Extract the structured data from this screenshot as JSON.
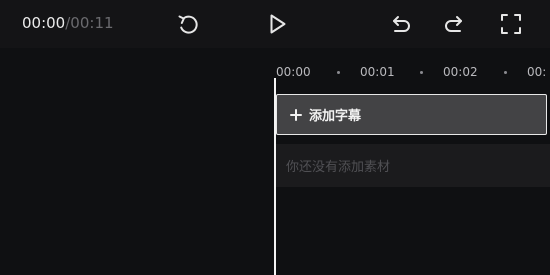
{
  "toolbar": {
    "current_time": "00:00",
    "separator": "/",
    "total_time": "00:11",
    "icons": [
      "refresh-icon",
      "play-icon",
      "undo-icon",
      "redo-icon",
      "fullscreen-icon"
    ]
  },
  "timeline": {
    "ticks": [
      "00:00",
      "00:01",
      "00:02",
      "00:"
    ],
    "subtitle_track_label": "添加字幕",
    "material_track_placeholder": "你还没有添加素材"
  },
  "colors": {
    "background": "#0f1012",
    "toolbar": "#141416",
    "subtitle_track": "#434345",
    "playhead": "#f4f4f4"
  }
}
